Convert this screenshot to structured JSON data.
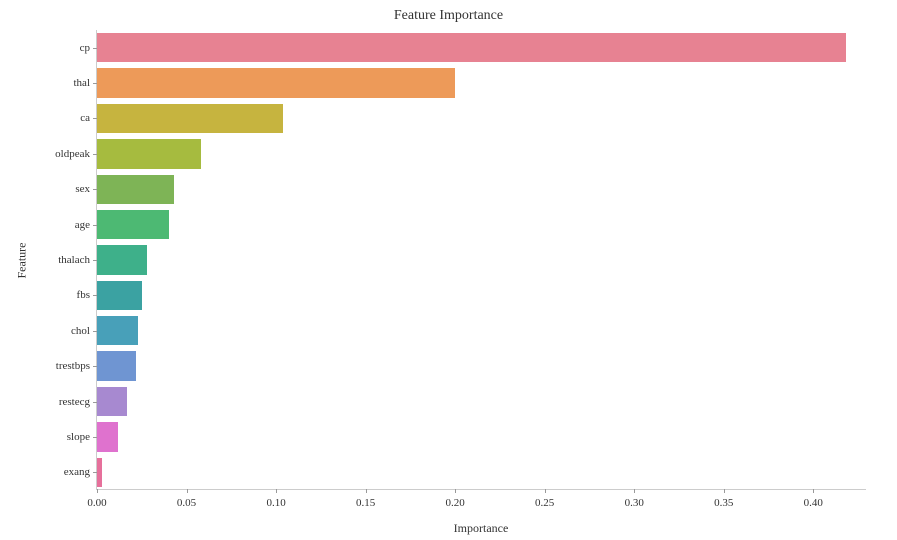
{
  "chart_data": {
    "type": "bar",
    "orientation": "horizontal",
    "title": "Feature Importance",
    "xlabel": "Importance",
    "ylabel": "Feature",
    "xlim": [
      0.0,
      0.43
    ],
    "xticks": [
      0.0,
      0.05,
      0.1,
      0.15,
      0.2,
      0.25,
      0.3,
      0.35,
      0.4
    ],
    "xtick_labels": [
      "0.00",
      "0.05",
      "0.10",
      "0.15",
      "0.20",
      "0.25",
      "0.30",
      "0.35",
      "0.40"
    ],
    "categories": [
      "cp",
      "thal",
      "ca",
      "oldpeak",
      "sex",
      "age",
      "thalach",
      "fbs",
      "chol",
      "trestbps",
      "restecg",
      "slope",
      "exang"
    ],
    "values": [
      0.418,
      0.2,
      0.104,
      0.058,
      0.043,
      0.04,
      0.028,
      0.025,
      0.023,
      0.022,
      0.017,
      0.012,
      0.003
    ],
    "colors": [
      "#e78292",
      "#ed9a59",
      "#c6b43f",
      "#a6bb3f",
      "#7eb456",
      "#4db973",
      "#3eb08a",
      "#3ba2a2",
      "#48a0b9",
      "#6f95d2",
      "#a789d0",
      "#df72ce",
      "#e6709b"
    ]
  }
}
